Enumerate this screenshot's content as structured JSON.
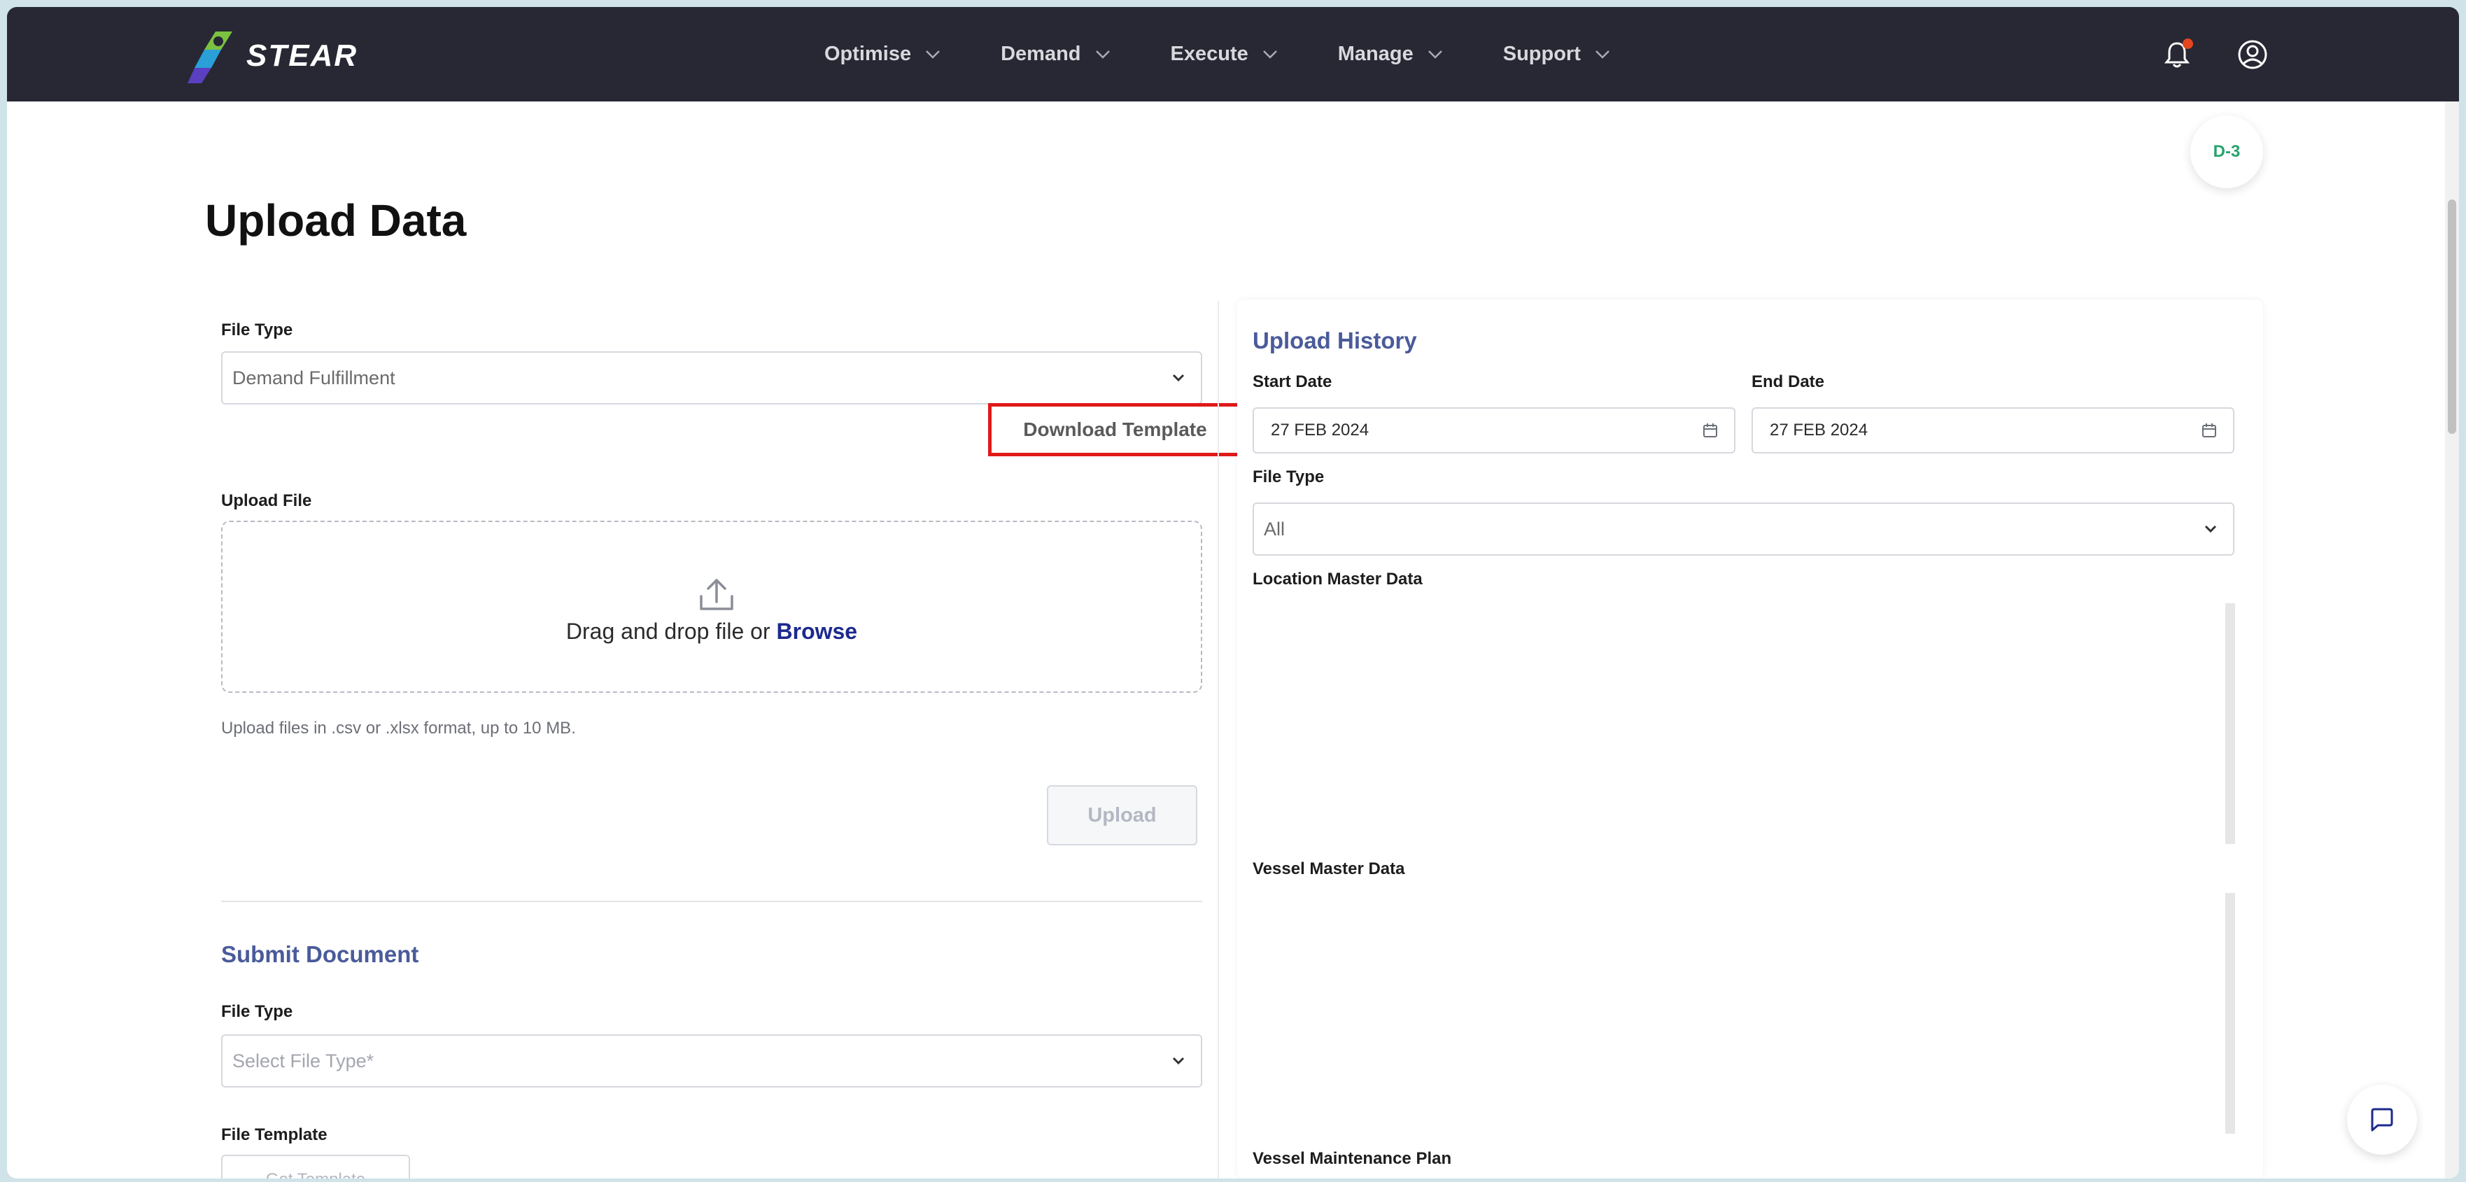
{
  "app": {
    "logo_text": "STEAR",
    "version_badge": "D-3"
  },
  "nav": {
    "items": [
      {
        "label": "Optimise"
      },
      {
        "label": "Demand"
      },
      {
        "label": "Execute"
      },
      {
        "label": "Manage"
      },
      {
        "label": "Support"
      }
    ]
  },
  "page": {
    "title": "Upload Data"
  },
  "upload_form": {
    "file_type_label": "File Type",
    "file_type_value": "Demand Fulfillment",
    "download_template_label": "Download Template",
    "upload_file_label": "Upload File",
    "dropzone_text": "Drag and drop file or",
    "dropzone_browse": "Browse",
    "hint": "Upload files in .csv or .xlsx format, up to 10 MB.",
    "upload_button": "Upload"
  },
  "submit_document": {
    "title": "Submit Document",
    "file_type_label": "File Type",
    "file_type_placeholder": "Select File Type*",
    "file_template_label": "File Template",
    "template_button": "Get Template"
  },
  "upload_history": {
    "title": "Upload History",
    "start_date_label": "Start Date",
    "start_date_value": "27 FEB 2024",
    "end_date_label": "End Date",
    "end_date_value": "27 FEB 2024",
    "file_type_label": "File Type",
    "file_type_value": "All",
    "groups": [
      {
        "title": "Location Master Data"
      },
      {
        "title": "Vessel Master Data"
      },
      {
        "title": "Vessel Maintenance Plan"
      }
    ]
  },
  "colors": {
    "topbar_bg": "#272833",
    "accent_blue": "#4a5b9a",
    "link_blue": "#1c2a8e",
    "highlight_red": "#e01919",
    "badge_green": "#27a36e",
    "notification_dot": "#e2461f"
  }
}
